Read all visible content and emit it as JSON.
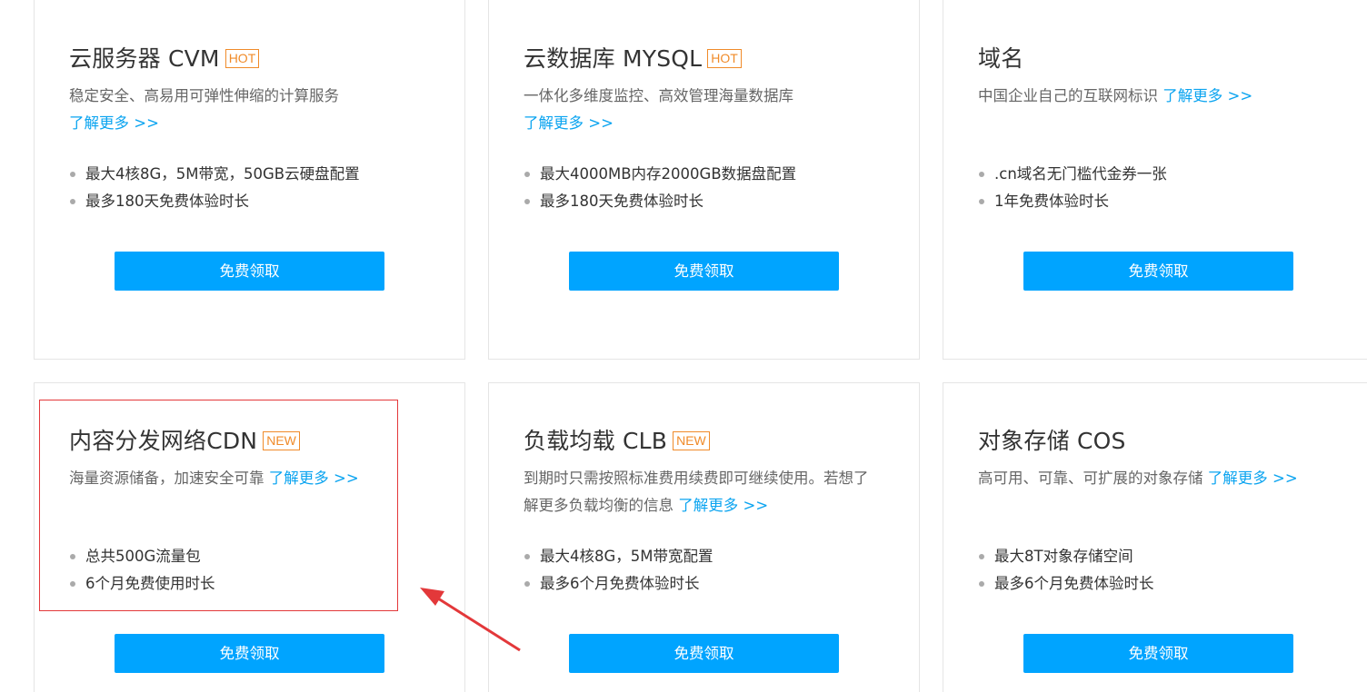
{
  "products": [
    {
      "title": "云服务器 CVM",
      "badge": "HOT",
      "desc": "稳定安全、高易用可弹性伸缩的计算服务",
      "more": "了解更多 >>",
      "features": [
        "最大4核8G，5M带宽，50GB云硬盘配置",
        "最多180天免费体验时长"
      ],
      "button": "免费领取"
    },
    {
      "title": "云数据库 MYSQL",
      "badge": "HOT",
      "desc": "一体化多维度监控、高效管理海量数据库",
      "more": "了解更多 >>",
      "features": [
        "最大4000MB内存2000GB数据盘配置",
        "最多180天免费体验时长"
      ],
      "button": "免费领取"
    },
    {
      "title": "域名",
      "badge": "",
      "desc": "中国企业自己的互联网标识",
      "more": "了解更多 >>",
      "features": [
        ".cn域名无门槛代金券一张",
        "1年免费体验时长"
      ],
      "button": "免费领取"
    },
    {
      "title": "内容分发网络CDN",
      "badge": "NEW",
      "desc": "海量资源储备，加速安全可靠",
      "more": "了解更多 >>",
      "features": [
        "总共500G流量包",
        "6个月免费使用时长"
      ],
      "button": "免费领取"
    },
    {
      "title": "负载均载 CLB",
      "badge": "NEW",
      "desc": "到期时只需按照标准费用续费即可继续使用。若想了解更多负载均衡的信息",
      "more": "了解更多 >>",
      "features": [
        "最大4核8G，5M带宽配置",
        "最多6个月免费体验时长"
      ],
      "button": "免费领取"
    },
    {
      "title": "对象存储 COS",
      "badge": "",
      "desc": "高可用、可靠、可扩展的对象存储",
      "more": "了解更多 >>",
      "features": [
        "最大8T对象存储空间",
        "最多6个月免费体验时长"
      ],
      "button": "免费领取"
    }
  ],
  "colors": {
    "accent_button": "#00a4ff",
    "link": "#0ba4f0",
    "badge": "#f08b2a",
    "annotation": "#e3383a",
    "card_border": "#e5e5e5"
  }
}
